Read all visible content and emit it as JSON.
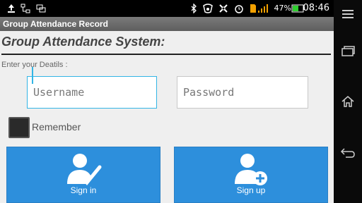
{
  "status_bar": {
    "battery_percent": "47%",
    "time": "08:46",
    "icons": [
      "upload-icon",
      "network-icon",
      "screen-icon",
      "bluetooth-icon",
      "nfc-icon",
      "signal-off-icon",
      "alarm-icon",
      "sim-icon",
      "signal-icon",
      "battery-icon"
    ]
  },
  "app": {
    "title": "Group Attendance Record",
    "heading": "Group Attendance System:",
    "subtitle": "Enter your Deatils :",
    "username_placeholder": "Username",
    "password_placeholder": "Password",
    "remember_label": "Remember",
    "signin_label": "Sign in",
    "signup_label": "Sign up"
  },
  "colors": {
    "accent": "#33b5e5",
    "button": "#2d8fdc"
  }
}
